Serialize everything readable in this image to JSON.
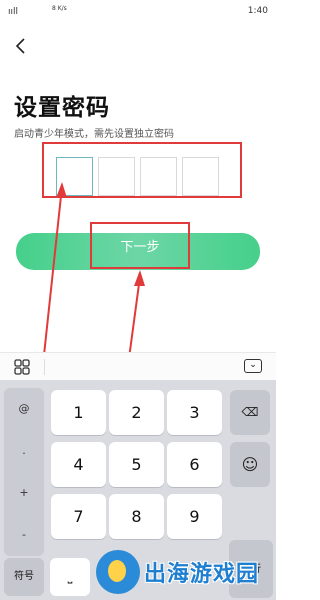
{
  "status_bar": {
    "signal": "ııll",
    "network_speed": "8 K/s",
    "time": "1:40",
    "battery": "▮"
  },
  "header": {
    "back_icon": "chevron-left-icon"
  },
  "page": {
    "title": "设置密码",
    "subtitle": "启动青少年模式，需先设置独立密码"
  },
  "pin": {
    "digits": [
      "",
      "",
      "",
      ""
    ]
  },
  "next_button": {
    "label": "下一步"
  },
  "keyboard": {
    "side_keys": [
      "@",
      ".",
      "+",
      "-"
    ],
    "keys": [
      "1",
      "2",
      "3",
      "4",
      "5",
      "6",
      "7",
      "8",
      "9"
    ],
    "delete_label": "⌫",
    "emoji_label": "☺",
    "symbol_label": "符号",
    "space_label": "⎵",
    "enter_label": "换行"
  },
  "watermark": {
    "text": "出海游戏园"
  },
  "colors": {
    "accent": "#45d08a",
    "highlight": "#e03a3a",
    "keyboard_bg": "#d9dbe1"
  }
}
